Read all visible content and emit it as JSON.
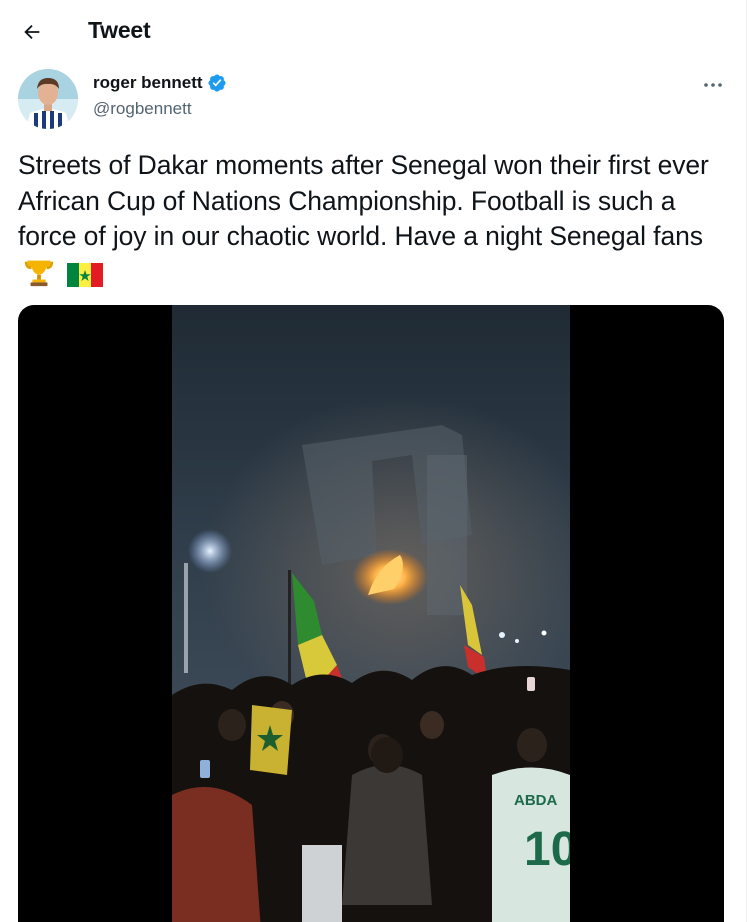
{
  "header": {
    "back_icon": "arrow-left-icon",
    "title": "Tweet"
  },
  "author": {
    "display_name": "roger bennett",
    "handle": "@rogbennett",
    "verified_icon": "verified-badge-icon",
    "avatar_icon": "avatar"
  },
  "menu": {
    "more_icon": "more-horizontal-icon"
  },
  "tweet": {
    "text": "Streets of Dakar moments after Senegal won their first ever African Cup of Nations Championship. Football is such a force of joy in our chaotic world. Have a night Senegal fans",
    "emojis": [
      "trophy-icon",
      "senegal-flag-icon"
    ]
  },
  "media": {
    "type": "video",
    "jersey_text": "ABDA",
    "jersey_number": "10"
  },
  "colors": {
    "text": "#0f1419",
    "secondary_text": "#536471",
    "verified": "#1d9bf0",
    "media_background": "#000000"
  }
}
